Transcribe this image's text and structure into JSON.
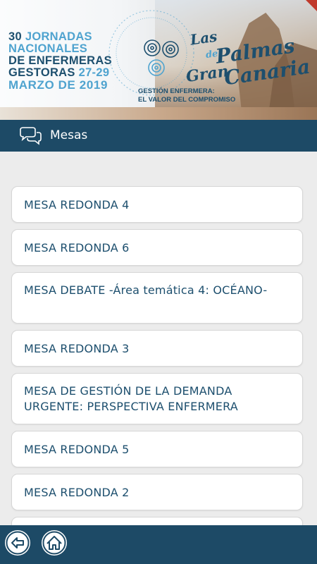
{
  "banner": {
    "line1_num": "30",
    "line1_word": "JORNADAS",
    "line2": "NACIONALES",
    "line3": "DE ENFERMERAS",
    "line4_word": "GESTORAS",
    "line4_dates": "27-29",
    "line5": "MARZO DE 2019",
    "place_las": "Las",
    "place_de": "de",
    "place_palmas": "Palmas",
    "place_gran": "Gran",
    "place_canaria": "Canaria",
    "tagline_1": "GESTIÓN ENFERMERA:",
    "tagline_2": "EL VALOR DEL COMPROMISO"
  },
  "header": {
    "title": "Mesas",
    "icon": "chat-bubbles-icon"
  },
  "items": [
    {
      "label": "MESA REDONDA 4"
    },
    {
      "label": "MESA REDONDA 6"
    },
    {
      "label": "MESA DEBATE -Área temática 4: OCÉANO-"
    },
    {
      "label": "MESA REDONDA 3"
    },
    {
      "label": "MESA DE GESTIÓN DE LA DEMANDA URGENTE: PERSPECTIVA ENFERMERA"
    },
    {
      "label": "MESA REDONDA 5"
    },
    {
      "label": "MESA REDONDA 2"
    }
  ],
  "footer": {
    "back_icon": "back-arrow-icon",
    "home_icon": "home-icon"
  },
  "colors": {
    "brand_dark": "#1d4a66",
    "text_blue": "#1d4f6e",
    "accent_light_blue": "#4fa3cf",
    "background": "#ececec"
  }
}
